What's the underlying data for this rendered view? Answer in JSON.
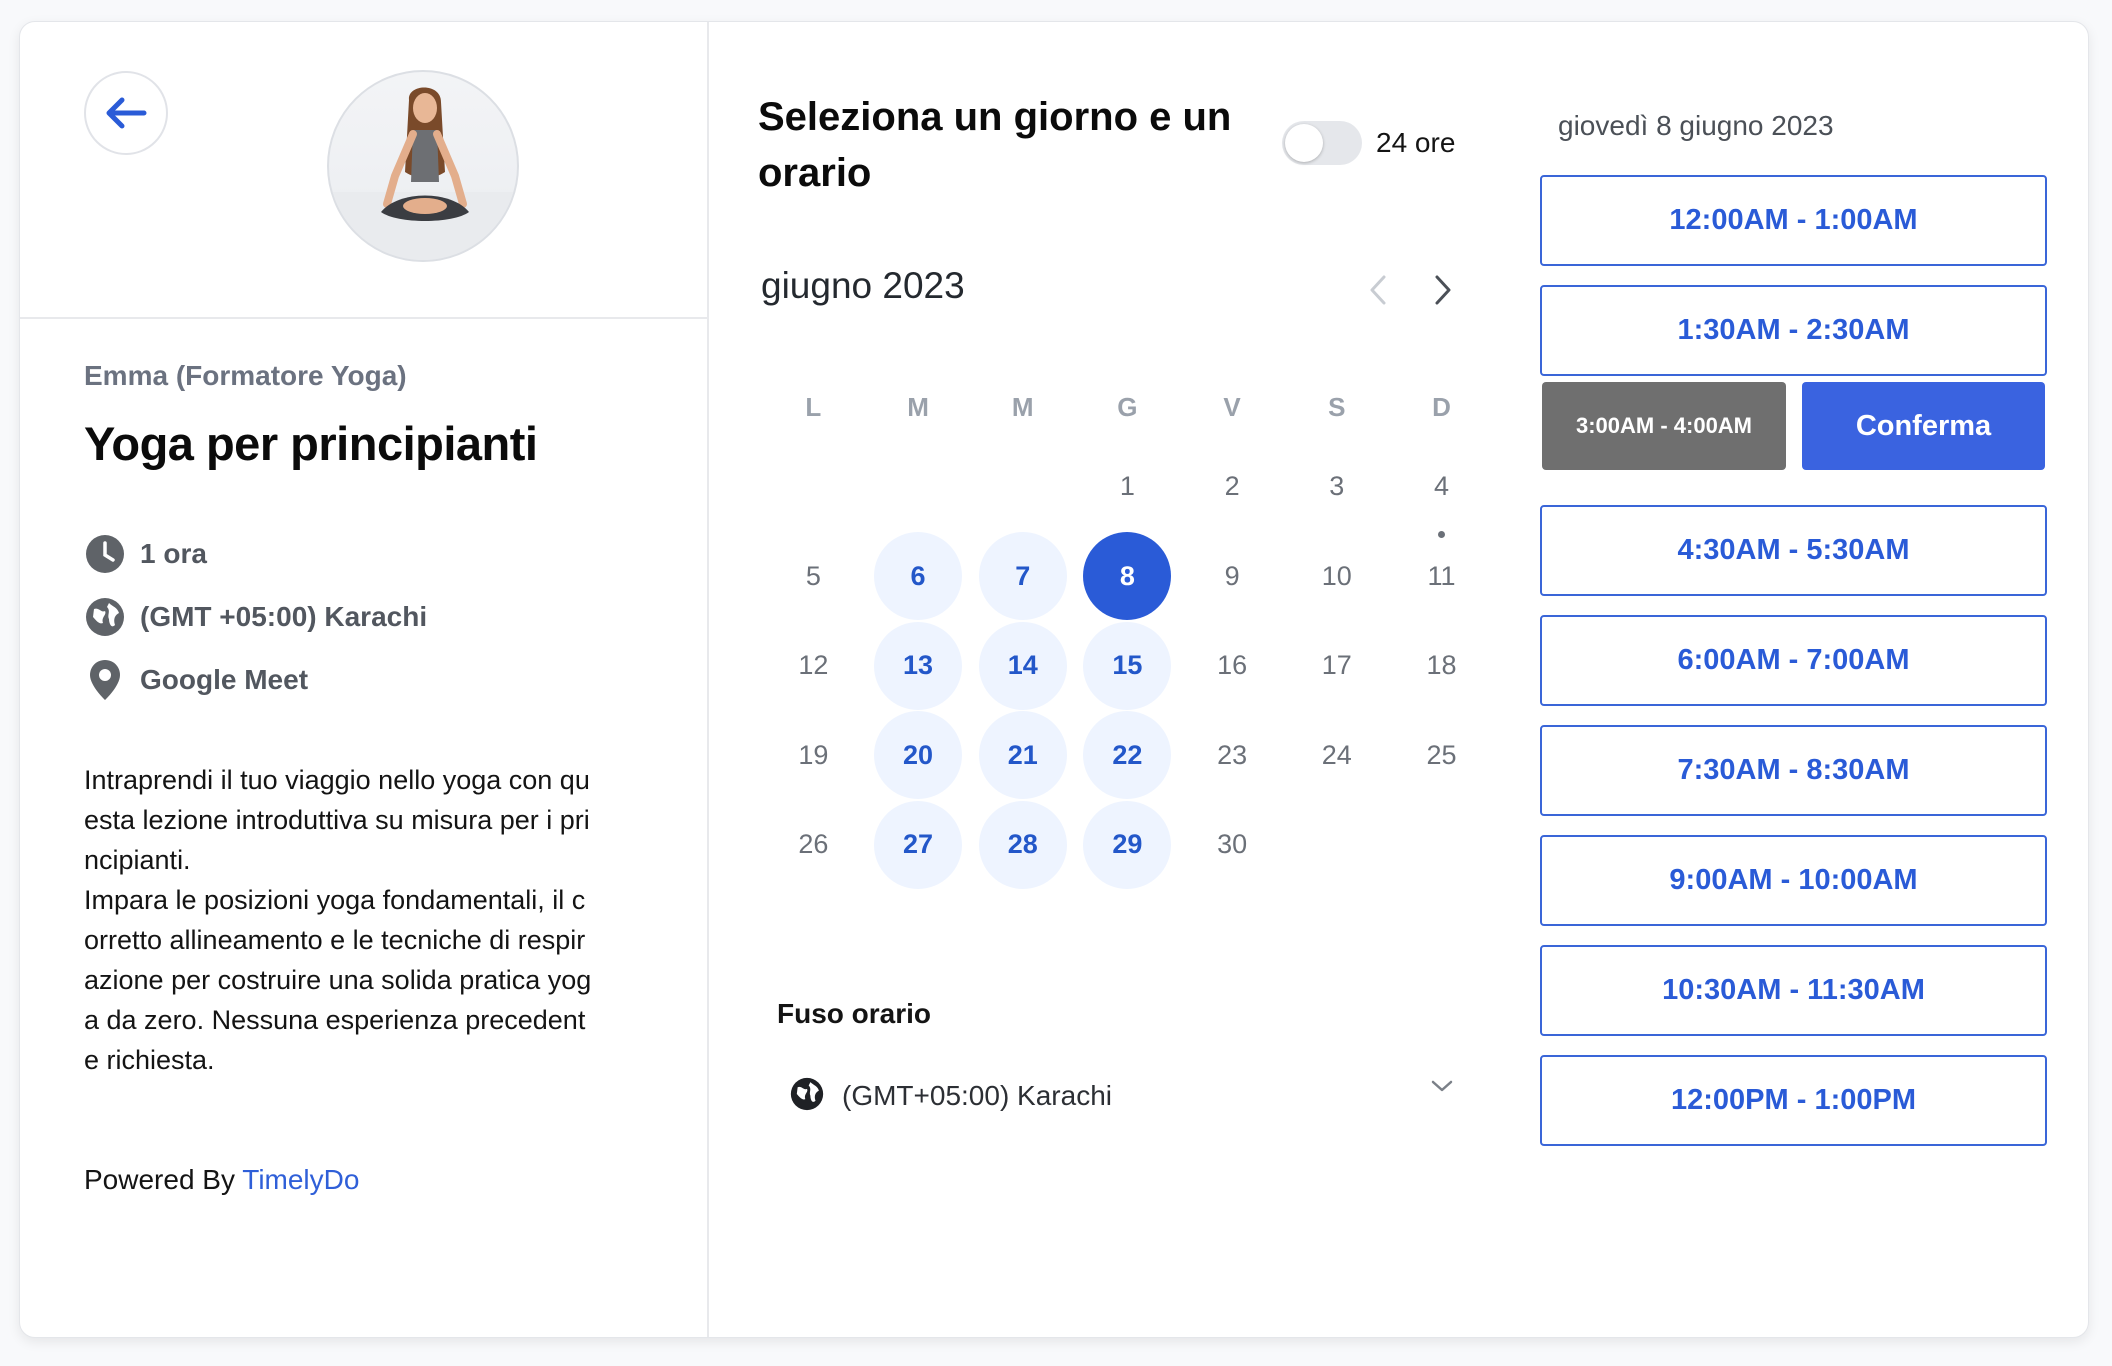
{
  "event": {
    "host": "Emma (Formatore Yoga)",
    "title": "Yoga per principianti",
    "duration": "1 ora",
    "timezone": "(GMT +05:00) Karachi",
    "location": "Google Meet",
    "description": "Intraprendi il tuo viaggio nello yoga con qu\nesta lezione introduttiva su misura per i pri\nncipianti.\nImpara le posizioni yoga fondamentali, il c\norretto allineamento e le tecniche di respir\nazione per costruire una solida pratica yog\na da zero. Nessuna esperienza precedent\ne richiesta.",
    "powered_prefix": "Powered By",
    "powered_brand": "TimelyDo"
  },
  "calendar": {
    "heading": "Seleziona un giorno e un orario",
    "toggle_label": "24 ore",
    "month_label": "giugno 2023",
    "weekdays": [
      "L",
      "M",
      "M",
      "G",
      "V",
      "S",
      "D"
    ],
    "weeks": [
      [
        "",
        "",
        "",
        "1",
        "2",
        "3",
        "4"
      ],
      [
        "5",
        "6",
        "7",
        "8",
        "9",
        "10",
        "11"
      ],
      [
        "12",
        "13",
        "14",
        "15",
        "16",
        "17",
        "18"
      ],
      [
        "19",
        "20",
        "21",
        "22",
        "23",
        "24",
        "25"
      ],
      [
        "26",
        "27",
        "28",
        "29",
        "30",
        "",
        ""
      ]
    ],
    "available": [
      "6",
      "7",
      "13",
      "14",
      "15",
      "20",
      "21",
      "22",
      "27",
      "28",
      "29"
    ],
    "selected": "8",
    "today": "4"
  },
  "timezone_select": {
    "label": "Fuso orario",
    "value": "(GMT+05:00) Karachi"
  },
  "slots": {
    "date_label": "giovedì 8 giugno 2023",
    "times": [
      "12:00AM - 1:00AM",
      "1:30AM - 2:30AM",
      "3:00AM - 4:00AM",
      "4:30AM - 5:30AM",
      "6:00AM - 7:00AM",
      "7:30AM - 8:30AM",
      "9:00AM - 10:00AM",
      "10:30AM - 11:30AM",
      "12:00PM - 1:00PM"
    ],
    "selected_index": 2,
    "confirm_label": "Conferma"
  },
  "colors": {
    "accent": "#2a5bd7",
    "available_bg": "#eef4ff",
    "selected_slot_bg": "#6f6f6f"
  }
}
